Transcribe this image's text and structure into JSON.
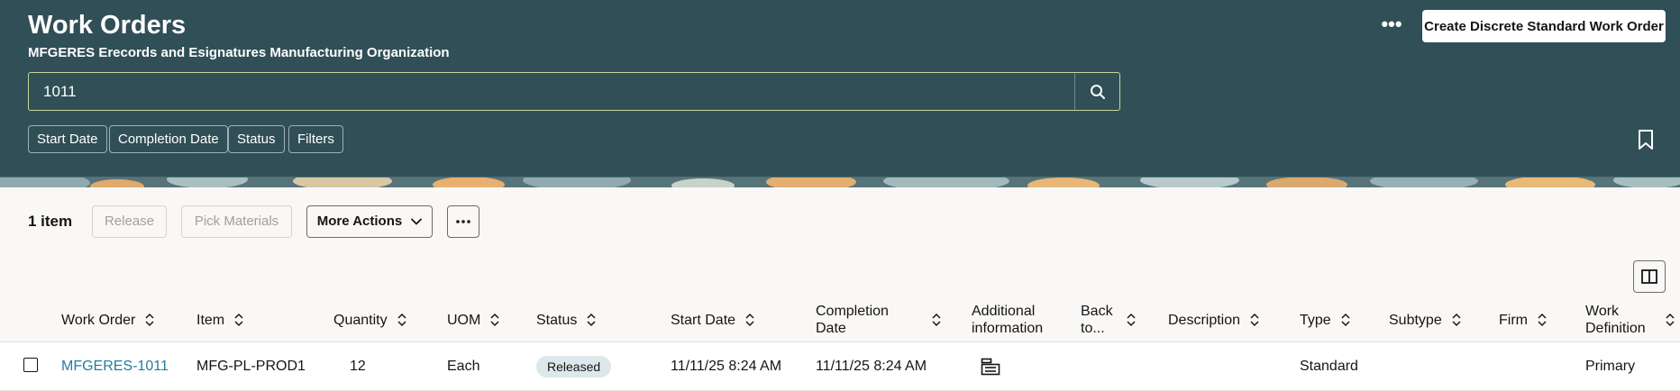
{
  "header": {
    "title": "Work Orders",
    "subtitle": "MFGERES Erecords and Esignatures Manufacturing Organization",
    "create_button": "Create Discrete Standard Work Order",
    "overflow": "•••"
  },
  "search": {
    "value": "1011"
  },
  "filters": [
    "Start Date",
    "Completion Date",
    "Status",
    "Filters"
  ],
  "toolbar": {
    "item_count": "1 item",
    "release": "Release",
    "pick_materials": "Pick Materials",
    "more_actions": "More Actions",
    "dots": "•••"
  },
  "table": {
    "columns": [
      {
        "line1": "Work Order",
        "line2": ""
      },
      {
        "line1": "Item",
        "line2": ""
      },
      {
        "line1": "Quantity",
        "line2": ""
      },
      {
        "line1": "UOM",
        "line2": ""
      },
      {
        "line1": "Status",
        "line2": ""
      },
      {
        "line1": "Start Date",
        "line2": ""
      },
      {
        "line1": "Completion",
        "line2": "Date"
      },
      {
        "line1": "Additional",
        "line2": "information"
      },
      {
        "line1": "Back",
        "line2": "to..."
      },
      {
        "line1": "Description",
        "line2": ""
      },
      {
        "line1": "Type",
        "line2": ""
      },
      {
        "line1": "Subtype",
        "line2": ""
      },
      {
        "line1": "Firm",
        "line2": ""
      },
      {
        "line1": "Work",
        "line2": "Definition"
      }
    ],
    "rows": [
      {
        "work_order": "MFGERES-1011",
        "item": "MFG-PL-PROD1",
        "quantity": "12",
        "uom": "Each",
        "status": "Released",
        "start_date": "11/11/25 8:24 AM",
        "completion_date": "11/11/25 8:24 AM",
        "type": "Standard",
        "work_definition": "Primary"
      }
    ]
  },
  "colors": {
    "header_bg": "#304f57",
    "link": "#227e9e",
    "badge_bg": "#dde7ec"
  },
  "icons": [
    "search-icon",
    "bookmark-icon",
    "chevron-down-icon",
    "sort-icon",
    "column-toggle-icon",
    "details-icon"
  ]
}
